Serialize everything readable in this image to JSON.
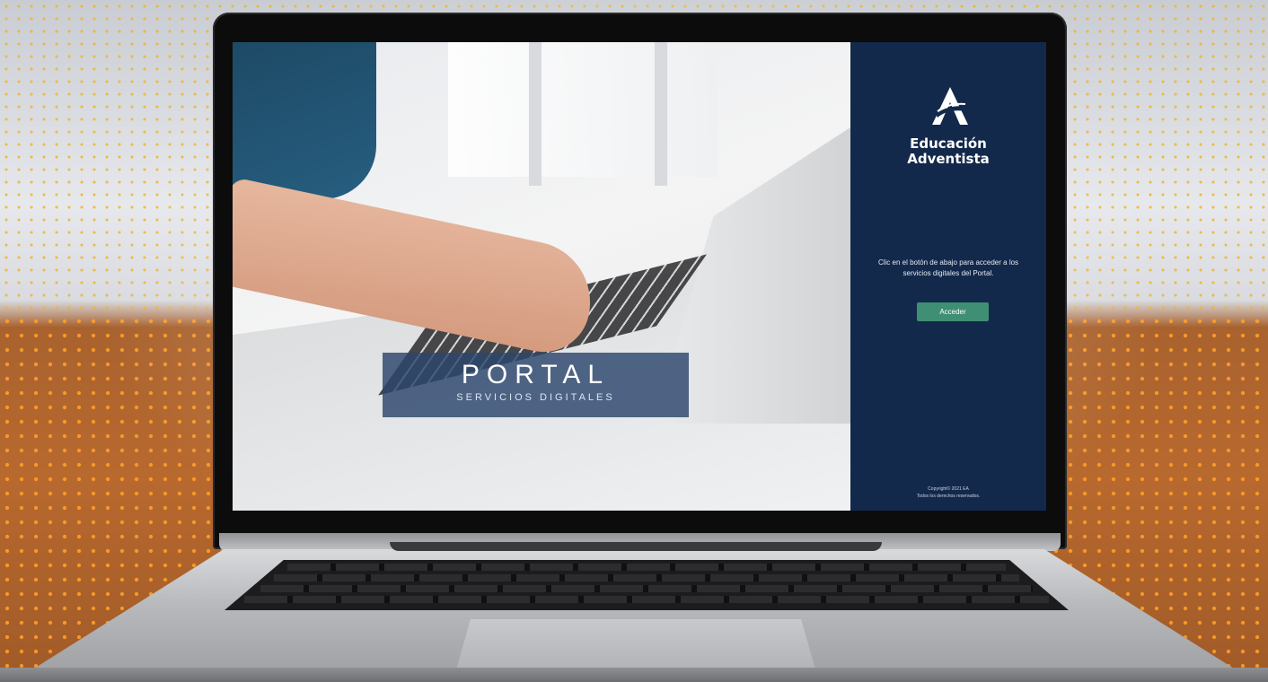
{
  "portal_banner": {
    "title": "PORTAL",
    "subtitle": "SERVICIOS DIGITALES"
  },
  "brand": {
    "line1": "Educación",
    "line2": "Adventista",
    "logo_icon": "adventist-education-logo-icon"
  },
  "panel": {
    "instruction": "Clic en el botón de abajo para acceder a los servicios digitales del Portal.",
    "access_button_label": "Acceder",
    "copyright_line1": "Copyright© 2021 EA",
    "copyright_line2": "Todos los derechos reservados."
  },
  "colors": {
    "panel_bg": "#13294b",
    "button_bg": "#3f8f74",
    "banner_bg": "#2c466c"
  }
}
